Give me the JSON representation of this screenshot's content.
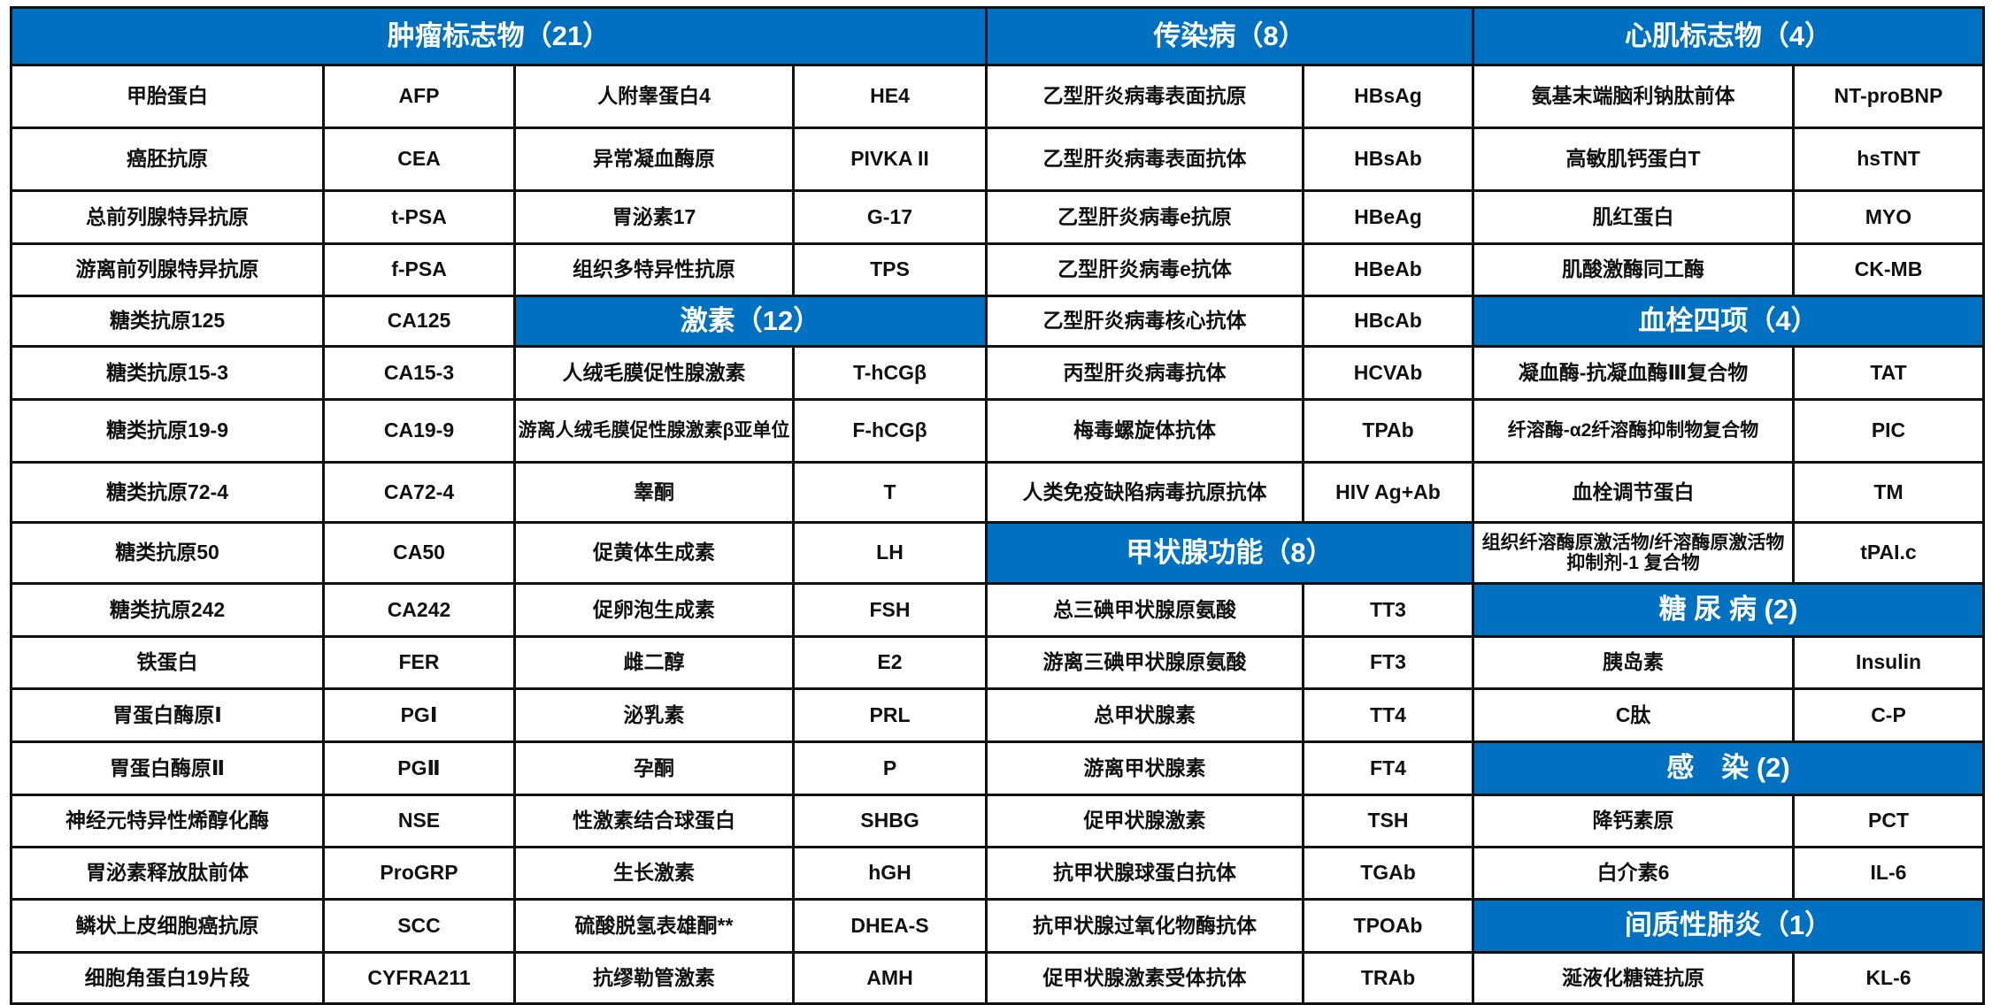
{
  "colors": {
    "header_bg": "#0070C0",
    "header_text": "#FFFFFF",
    "border": "#111111"
  },
  "groups": {
    "tumor": {
      "title": "肿瘤标志物（21）",
      "items": [
        {
          "name": "甲胎蛋白",
          "abbr": "AFP"
        },
        {
          "name": "癌胚抗原",
          "abbr": "CEA"
        },
        {
          "name": "总前列腺特异抗原",
          "abbr": "t-PSA"
        },
        {
          "name": "游离前列腺特异抗原",
          "abbr": "f-PSA"
        },
        {
          "name": "糖类抗原125",
          "abbr": "CA125"
        },
        {
          "name": "糖类抗原15-3",
          "abbr": "CA15-3"
        },
        {
          "name": "糖类抗原19-9",
          "abbr": "CA19-9"
        },
        {
          "name": "糖类抗原72-4",
          "abbr": "CA72-4"
        },
        {
          "name": "糖类抗原50",
          "abbr": "CA50"
        },
        {
          "name": "糖类抗原242",
          "abbr": "CA242"
        },
        {
          "name": "铁蛋白",
          "abbr": "FER"
        },
        {
          "name": "胃蛋白酶原Ⅰ",
          "abbr": "PGⅠ"
        },
        {
          "name": "胃蛋白酶原Ⅱ",
          "abbr": "PGⅡ"
        },
        {
          "name": "神经元特异性烯醇化酶",
          "abbr": "NSE"
        },
        {
          "name": "胃泌素释放肽前体",
          "abbr": "ProGRP"
        },
        {
          "name": "鳞状上皮细胞癌抗原",
          "abbr": "SCC"
        },
        {
          "name": "细胞角蛋白19片段",
          "abbr": "CYFRA211"
        },
        {
          "name": "人附睾蛋白4",
          "abbr": "HE4"
        },
        {
          "name": "异常凝血酶原",
          "abbr": "PIVKA II"
        },
        {
          "name": "胃泌素17",
          "abbr": "G-17"
        },
        {
          "name": "组织多特异性抗原",
          "abbr": "TPS"
        }
      ]
    },
    "hormone": {
      "title": "激素（12）",
      "items": [
        {
          "name": "人绒毛膜促性腺激素",
          "abbr": "T-hCGβ"
        },
        {
          "name": "游离人绒毛膜促性腺激素β亚单位",
          "abbr": "F-hCGβ"
        },
        {
          "name": "睾酮",
          "abbr": "T"
        },
        {
          "name": "促黄体生成素",
          "abbr": "LH"
        },
        {
          "name": "促卵泡生成素",
          "abbr": "FSH"
        },
        {
          "name": "雌二醇",
          "abbr": "E2"
        },
        {
          "name": "泌乳素",
          "abbr": "PRL"
        },
        {
          "name": "孕酮",
          "abbr": "P"
        },
        {
          "name": "性激素结合球蛋白",
          "abbr": "SHBG"
        },
        {
          "name": "生长激素",
          "abbr": "hGH"
        },
        {
          "name": "硫酸脱氢表雄酮**",
          "abbr": "DHEA-S"
        },
        {
          "name": "抗缪勒管激素",
          "abbr": "AMH"
        }
      ]
    },
    "infectious": {
      "title": "传染病（8）",
      "items": [
        {
          "name": "乙型肝炎病毒表面抗原",
          "abbr": "HBsAg"
        },
        {
          "name": "乙型肝炎病毒表面抗体",
          "abbr": "HBsAb"
        },
        {
          "name": "乙型肝炎病毒e抗原",
          "abbr": "HBeAg"
        },
        {
          "name": "乙型肝炎病毒e抗体",
          "abbr": "HBeAb"
        },
        {
          "name": "乙型肝炎病毒核心抗体",
          "abbr": "HBcAb"
        },
        {
          "name": "丙型肝炎病毒抗体",
          "abbr": "HCVAb"
        },
        {
          "name": "梅毒螺旋体抗体",
          "abbr": "TPAb"
        },
        {
          "name": "人类免疫缺陷病毒抗原抗体",
          "abbr": "HIV Ag+Ab"
        }
      ]
    },
    "thyroid": {
      "title": "甲状腺功能（8）",
      "items": [
        {
          "name": "总三碘甲状腺原氨酸",
          "abbr": "TT3"
        },
        {
          "name": "游离三碘甲状腺原氨酸",
          "abbr": "FT3"
        },
        {
          "name": "总甲状腺素",
          "abbr": "TT4"
        },
        {
          "name": "游离甲状腺素",
          "abbr": "FT4"
        },
        {
          "name": "促甲状腺激素",
          "abbr": "TSH"
        },
        {
          "name": "抗甲状腺球蛋白抗体",
          "abbr": "TGAb"
        },
        {
          "name": "抗甲状腺过氧化物酶抗体",
          "abbr": "TPOAb"
        },
        {
          "name": "促甲状腺激素受体抗体",
          "abbr": "TRAb"
        }
      ]
    },
    "cardiac": {
      "title": "心肌标志物（4）",
      "items": [
        {
          "name": "氨基末端脑利钠肽前体",
          "abbr": "NT-proBNP"
        },
        {
          "name": "高敏肌钙蛋白T",
          "abbr": "hsTNT"
        },
        {
          "name": "肌红蛋白",
          "abbr": "MYO"
        },
        {
          "name": "肌酸激酶同工酶",
          "abbr": "CK-MB"
        }
      ]
    },
    "thrombus": {
      "title": "血栓四项（4）",
      "items": [
        {
          "name": "凝血酶-抗凝血酶Ⅲ复合物",
          "abbr": "TAT"
        },
        {
          "name": "纤溶酶-α2纤溶酶抑制物复合物",
          "abbr": "PIC"
        },
        {
          "name": "血栓调节蛋白",
          "abbr": "TM"
        },
        {
          "name": "组织纤溶酶原激活物/纤溶酶原激活物抑制剂-1 复合物",
          "abbr": "tPAI.c"
        }
      ]
    },
    "diabetes": {
      "title": "糖 尿 病 (2)",
      "items": [
        {
          "name": "胰岛素",
          "abbr": "Insulin"
        },
        {
          "name": "C肽",
          "abbr": "C-P"
        }
      ]
    },
    "infection": {
      "title": "感　染 (2)",
      "items": [
        {
          "name": "降钙素原",
          "abbr": "PCT"
        },
        {
          "name": "白介素6",
          "abbr": "IL-6"
        }
      ]
    },
    "ild": {
      "title": "间质性肺炎（1）",
      "items": [
        {
          "name": "涎液化糖链抗原",
          "abbr": "KL-6"
        }
      ]
    }
  }
}
